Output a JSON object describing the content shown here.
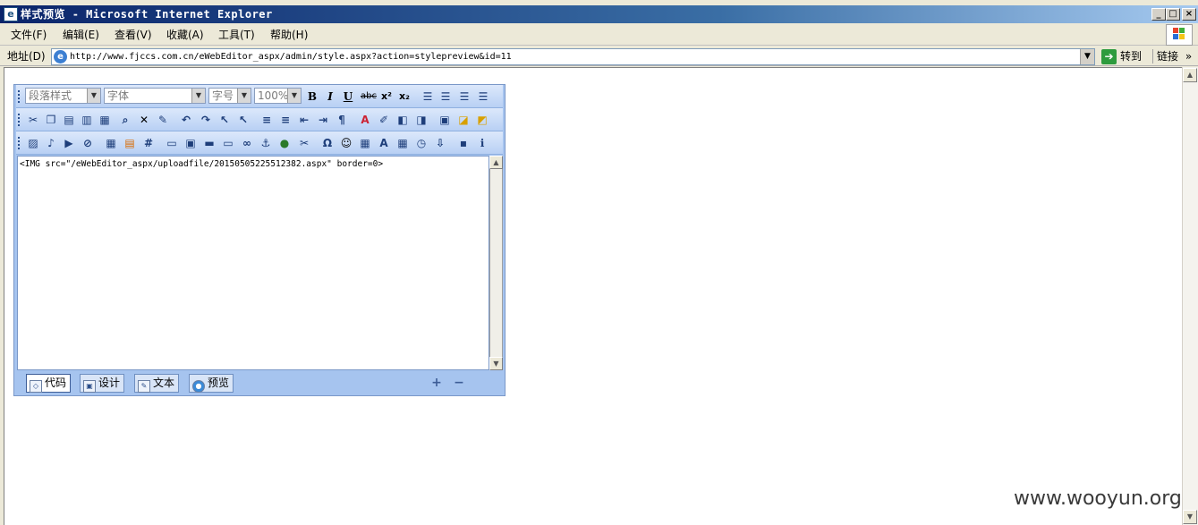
{
  "window": {
    "title": "样式预览 - Microsoft Internet Explorer",
    "app_icon": "ie-icon",
    "controls": {
      "minimize": "_",
      "maximize": "□",
      "close": "×"
    }
  },
  "menubar": {
    "items": [
      {
        "label": "文件(F)"
      },
      {
        "label": "编辑(E)"
      },
      {
        "label": "查看(V)"
      },
      {
        "label": "收藏(A)"
      },
      {
        "label": "工具(T)"
      },
      {
        "label": "帮助(H)"
      }
    ]
  },
  "addressbar": {
    "label": "地址(D)",
    "url": "http://www.fjccs.com.cn/eWebEditor_aspx/admin/style.aspx?action=stylepreview&id=11",
    "go_label": "转到",
    "links_label": "链接",
    "more_chevron": "»"
  },
  "editor": {
    "toolbar1": {
      "paragraph_style": "段落样式",
      "font_name": "字体",
      "font_size": "字号",
      "zoom": "100%",
      "format_buttons": [
        "B",
        "I",
        "U",
        "abc",
        "x²",
        "x₂"
      ]
    },
    "content": "<IMG src=\"/eWebEditor_aspx/uploadfile/20150505225512382.aspx\" border=0>",
    "modes": [
      {
        "label": "代码",
        "icon": "code-icon",
        "active": true
      },
      {
        "label": "设计",
        "icon": "design-icon",
        "active": false
      },
      {
        "label": "文本",
        "icon": "text-icon",
        "active": false
      },
      {
        "label": "预览",
        "icon": "preview-icon",
        "active": false
      }
    ],
    "zoom_in": "+",
    "zoom_out": "−"
  },
  "watermark": "www.wooyun.org"
}
